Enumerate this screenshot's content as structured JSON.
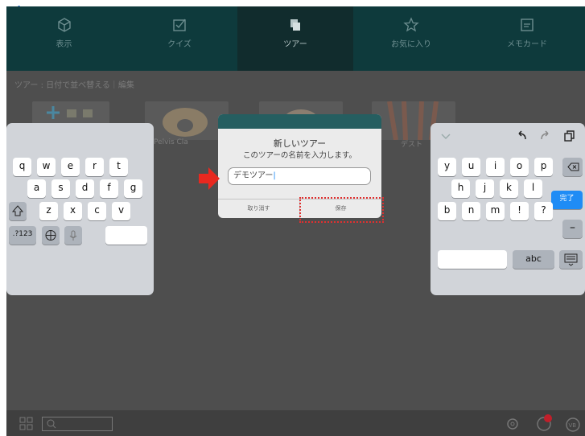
{
  "tabs": [
    {
      "label": "表示",
      "icon": "cube-icon"
    },
    {
      "label": "クイズ",
      "icon": "checkbox-icon"
    },
    {
      "label": "ツアー",
      "icon": "tour-icon",
      "active": true
    },
    {
      "label": "お気に入り",
      "icon": "star-icon"
    },
    {
      "label": "メモカード",
      "icon": "card-icon"
    }
  ],
  "subbar": {
    "text": "ツアー : 日付で並べ替える｜編集"
  },
  "thumbnails": {
    "label_1": "Pelvis Cla",
    "label_2": "デスト"
  },
  "dialog": {
    "title": "新しいツアー",
    "message": "このツアーの名前を入力します。",
    "input_value": "デモツアー",
    "cancel_label": "取り消す",
    "save_label": "保存"
  },
  "keyboard_left": {
    "row1": [
      "q",
      "w",
      "e",
      "r",
      "t"
    ],
    "row2": [
      "a",
      "s",
      "d",
      "f",
      "g"
    ],
    "row3": [
      "z",
      "x",
      "c",
      "v"
    ],
    "numbers_label": ".?123"
  },
  "keyboard_right": {
    "row1": [
      "y",
      "u",
      "i",
      "o",
      "p"
    ],
    "row2": [
      "h",
      "j",
      "k",
      "l"
    ],
    "row3": [
      "b",
      "n",
      "m",
      "!",
      "?"
    ],
    "done_label": "完了",
    "abc_label": "abc"
  },
  "colors": {
    "accent": "#0e3a3c",
    "highlight": "#e03030",
    "keyboard_done": "#1f8cf5"
  }
}
